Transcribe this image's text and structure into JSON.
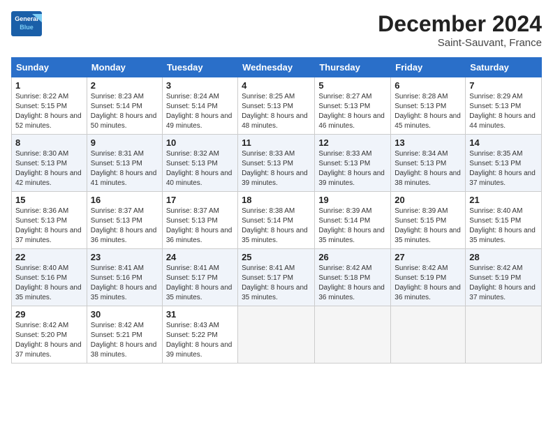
{
  "header": {
    "logo_text_general": "General",
    "logo_text_blue": "Blue",
    "month_year": "December 2024",
    "location": "Saint-Sauvant, France"
  },
  "weekdays": [
    "Sunday",
    "Monday",
    "Tuesday",
    "Wednesday",
    "Thursday",
    "Friday",
    "Saturday"
  ],
  "weeks": [
    [
      {
        "day": 1,
        "sunrise": "8:22 AM",
        "sunset": "5:15 PM",
        "daylight": "8 hours and 52 minutes"
      },
      {
        "day": 2,
        "sunrise": "8:23 AM",
        "sunset": "5:14 PM",
        "daylight": "8 hours and 50 minutes"
      },
      {
        "day": 3,
        "sunrise": "8:24 AM",
        "sunset": "5:14 PM",
        "daylight": "8 hours and 49 minutes"
      },
      {
        "day": 4,
        "sunrise": "8:25 AM",
        "sunset": "5:13 PM",
        "daylight": "8 hours and 48 minutes"
      },
      {
        "day": 5,
        "sunrise": "8:27 AM",
        "sunset": "5:13 PM",
        "daylight": "8 hours and 46 minutes"
      },
      {
        "day": 6,
        "sunrise": "8:28 AM",
        "sunset": "5:13 PM",
        "daylight": "8 hours and 45 minutes"
      },
      {
        "day": 7,
        "sunrise": "8:29 AM",
        "sunset": "5:13 PM",
        "daylight": "8 hours and 44 minutes"
      }
    ],
    [
      {
        "day": 8,
        "sunrise": "8:30 AM",
        "sunset": "5:13 PM",
        "daylight": "8 hours and 42 minutes"
      },
      {
        "day": 9,
        "sunrise": "8:31 AM",
        "sunset": "5:13 PM",
        "daylight": "8 hours and 41 minutes"
      },
      {
        "day": 10,
        "sunrise": "8:32 AM",
        "sunset": "5:13 PM",
        "daylight": "8 hours and 40 minutes"
      },
      {
        "day": 11,
        "sunrise": "8:33 AM",
        "sunset": "5:13 PM",
        "daylight": "8 hours and 39 minutes"
      },
      {
        "day": 12,
        "sunrise": "8:33 AM",
        "sunset": "5:13 PM",
        "daylight": "8 hours and 39 minutes"
      },
      {
        "day": 13,
        "sunrise": "8:34 AM",
        "sunset": "5:13 PM",
        "daylight": "8 hours and 38 minutes"
      },
      {
        "day": 14,
        "sunrise": "8:35 AM",
        "sunset": "5:13 PM",
        "daylight": "8 hours and 37 minutes"
      }
    ],
    [
      {
        "day": 15,
        "sunrise": "8:36 AM",
        "sunset": "5:13 PM",
        "daylight": "8 hours and 37 minutes"
      },
      {
        "day": 16,
        "sunrise": "8:37 AM",
        "sunset": "5:13 PM",
        "daylight": "8 hours and 36 minutes"
      },
      {
        "day": 17,
        "sunrise": "8:37 AM",
        "sunset": "5:13 PM",
        "daylight": "8 hours and 36 minutes"
      },
      {
        "day": 18,
        "sunrise": "8:38 AM",
        "sunset": "5:14 PM",
        "daylight": "8 hours and 35 minutes"
      },
      {
        "day": 19,
        "sunrise": "8:39 AM",
        "sunset": "5:14 PM",
        "daylight": "8 hours and 35 minutes"
      },
      {
        "day": 20,
        "sunrise": "8:39 AM",
        "sunset": "5:15 PM",
        "daylight": "8 hours and 35 minutes"
      },
      {
        "day": 21,
        "sunrise": "8:40 AM",
        "sunset": "5:15 PM",
        "daylight": "8 hours and 35 minutes"
      }
    ],
    [
      {
        "day": 22,
        "sunrise": "8:40 AM",
        "sunset": "5:16 PM",
        "daylight": "8 hours and 35 minutes"
      },
      {
        "day": 23,
        "sunrise": "8:41 AM",
        "sunset": "5:16 PM",
        "daylight": "8 hours and 35 minutes"
      },
      {
        "day": 24,
        "sunrise": "8:41 AM",
        "sunset": "5:17 PM",
        "daylight": "8 hours and 35 minutes"
      },
      {
        "day": 25,
        "sunrise": "8:41 AM",
        "sunset": "5:17 PM",
        "daylight": "8 hours and 35 minutes"
      },
      {
        "day": 26,
        "sunrise": "8:42 AM",
        "sunset": "5:18 PM",
        "daylight": "8 hours and 36 minutes"
      },
      {
        "day": 27,
        "sunrise": "8:42 AM",
        "sunset": "5:19 PM",
        "daylight": "8 hours and 36 minutes"
      },
      {
        "day": 28,
        "sunrise": "8:42 AM",
        "sunset": "5:19 PM",
        "daylight": "8 hours and 37 minutes"
      }
    ],
    [
      {
        "day": 29,
        "sunrise": "8:42 AM",
        "sunset": "5:20 PM",
        "daylight": "8 hours and 37 minutes"
      },
      {
        "day": 30,
        "sunrise": "8:42 AM",
        "sunset": "5:21 PM",
        "daylight": "8 hours and 38 minutes"
      },
      {
        "day": 31,
        "sunrise": "8:43 AM",
        "sunset": "5:22 PM",
        "daylight": "8 hours and 39 minutes"
      },
      null,
      null,
      null,
      null
    ]
  ]
}
